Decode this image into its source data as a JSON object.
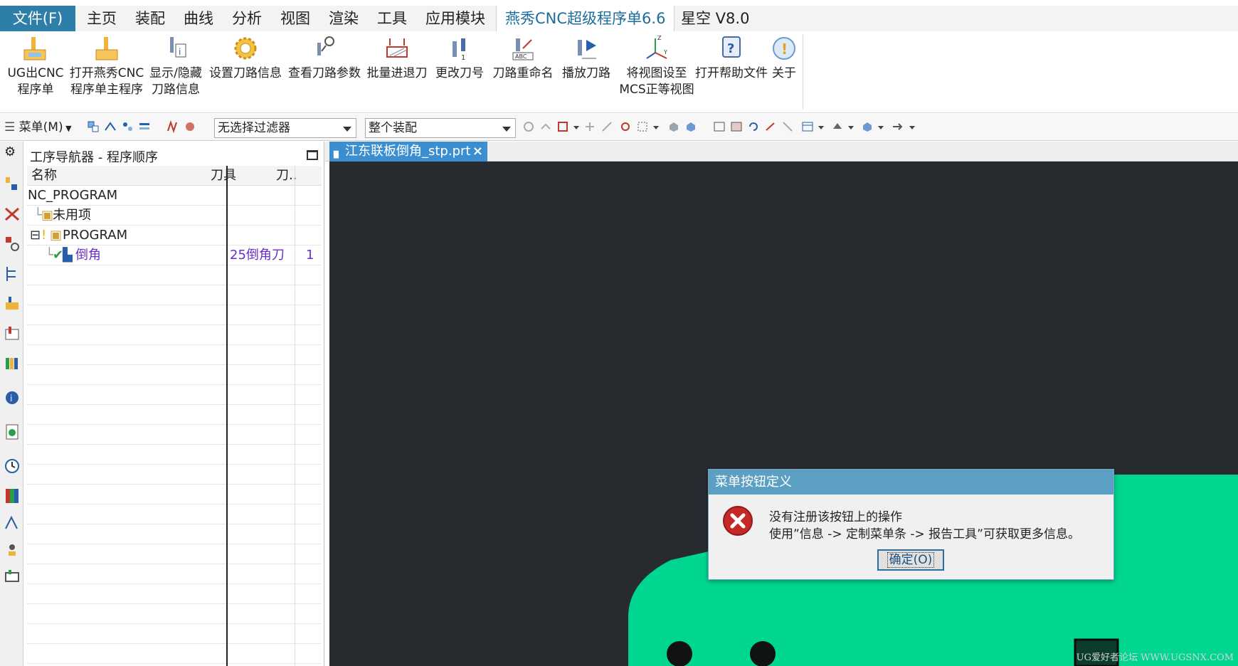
{
  "tabs": [
    {
      "label": "文件(F)"
    },
    {
      "label": "主页"
    },
    {
      "label": "装配"
    },
    {
      "label": "曲线"
    },
    {
      "label": "分析"
    },
    {
      "label": "视图"
    },
    {
      "label": "渲染"
    },
    {
      "label": "工具"
    },
    {
      "label": "应用模块"
    },
    {
      "label": "燕秀CNC超级程序单6.6"
    },
    {
      "label": "星空 V8.0"
    }
  ],
  "ribbon": {
    "buttons": [
      {
        "line1": "UG出CNC",
        "line2": "程序单"
      },
      {
        "line1": "打开燕秀CNC",
        "line2": "程序单主程序"
      },
      {
        "line1": "显示/隐藏",
        "line2": "刀路信息"
      },
      {
        "line1": "设置刀路信息",
        "line2": ""
      },
      {
        "line1": "查看刀路参数",
        "line2": ""
      },
      {
        "line1": "批量进退刀",
        "line2": ""
      },
      {
        "line1": "更改刀号",
        "line2": ""
      },
      {
        "line1": "刀路重命名",
        "line2": ""
      },
      {
        "line1": "播放刀路",
        "line2": ""
      },
      {
        "line1": "将视图设至",
        "line2": "MCS正等视图"
      },
      {
        "line1": "打开帮助文件",
        "line2": ""
      },
      {
        "line1": "关于",
        "line2": ""
      }
    ]
  },
  "toolbar": {
    "menu_label": "菜单(M)",
    "filter_value": "无选择过滤器",
    "assembly_value": "整个装配"
  },
  "navigator": {
    "title": "工序导航器 - 程序顺序",
    "columns": [
      "名称",
      "刀具",
      "刀.."
    ],
    "rows": [
      {
        "name": "NC_PROGRAM",
        "tool": "",
        "num": ""
      },
      {
        "name": "未用项",
        "tool": "",
        "num": ""
      },
      {
        "name": "PROGRAM",
        "tool": "",
        "num": ""
      },
      {
        "name": "倒角",
        "tool": "25倒角刀",
        "num": "1"
      }
    ]
  },
  "document": {
    "tab_label": "江东联板倒角_stp.prt",
    "close_glyph": "×"
  },
  "dialog": {
    "title": "菜单按钮定义",
    "message": "没有注册该按钮上的操作",
    "detail": "使用”信息 -> 定制菜单条 -> 报告工具”可获取更多信息。",
    "ok_label": "确定(O)"
  },
  "watermark": "UG爱好者论坛 WWW.UGSNX.COM",
  "colors": {
    "file_tab": "#2d7ea8",
    "active_tab_text": "#1c6e9c",
    "doc_tab": "#3b8fd0",
    "viewport_bg": "#272b30",
    "part": "#00d68f",
    "dialog_title": "#5b9fc2",
    "selected_row_text": "#6a2fc4"
  }
}
